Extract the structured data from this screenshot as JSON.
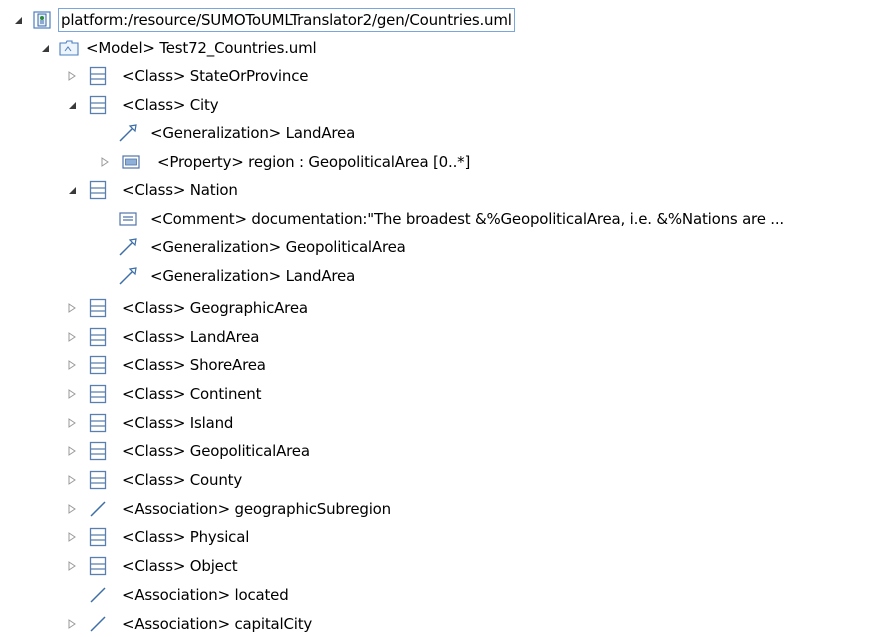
{
  "root": {
    "label": "platform:/resource/SUMOToUMLTranslator2/gen/Countries.uml",
    "icon": "uml-resource-icon",
    "expanded": true
  },
  "model": {
    "label": "<Model> Test72_Countries.uml",
    "icon": "model-icon",
    "expanded": true
  },
  "items": [
    {
      "label": "<Class> StateOrProvince",
      "icon": "class-icon",
      "expanded": false
    },
    {
      "label": "<Class> City",
      "icon": "class-icon",
      "expanded": true
    },
    {
      "label": "<Generalization> LandArea",
      "icon": "generalization-icon"
    },
    {
      "label": "<Property> region : GeopoliticalArea [0..*]",
      "icon": "property-icon",
      "expanded": false
    },
    {
      "label": "<Class> Nation",
      "icon": "class-icon",
      "expanded": true
    },
    {
      "label": "<Comment> documentation:\"The broadest &%GeopoliticalArea, i.e. &%Nations are ...",
      "icon": "comment-icon"
    },
    {
      "label": "<Generalization> GeopoliticalArea",
      "icon": "generalization-icon"
    },
    {
      "label": "<Generalization> LandArea",
      "icon": "generalization-icon"
    },
    {
      "label": "<Class> GeographicArea",
      "icon": "class-icon",
      "expanded": false
    },
    {
      "label": "<Class> LandArea",
      "icon": "class-icon",
      "expanded": false
    },
    {
      "label": "<Class> ShoreArea",
      "icon": "class-icon",
      "expanded": false
    },
    {
      "label": "<Class> Continent",
      "icon": "class-icon",
      "expanded": false
    },
    {
      "label": "<Class> Island",
      "icon": "class-icon",
      "expanded": false
    },
    {
      "label": "<Class> GeopoliticalArea",
      "icon": "class-icon",
      "expanded": false
    },
    {
      "label": "<Class> County",
      "icon": "class-icon",
      "expanded": false
    },
    {
      "label": "<Association> geographicSubregion",
      "icon": "association-icon",
      "expanded": false
    },
    {
      "label": "<Class> Physical",
      "icon": "class-icon",
      "expanded": false
    },
    {
      "label": "<Class> Object",
      "icon": "class-icon",
      "expanded": false
    },
    {
      "label": "<Association> located",
      "icon": "association-icon"
    },
    {
      "label": "<Association> capitalCity",
      "icon": "association-icon",
      "expanded": false
    }
  ]
}
